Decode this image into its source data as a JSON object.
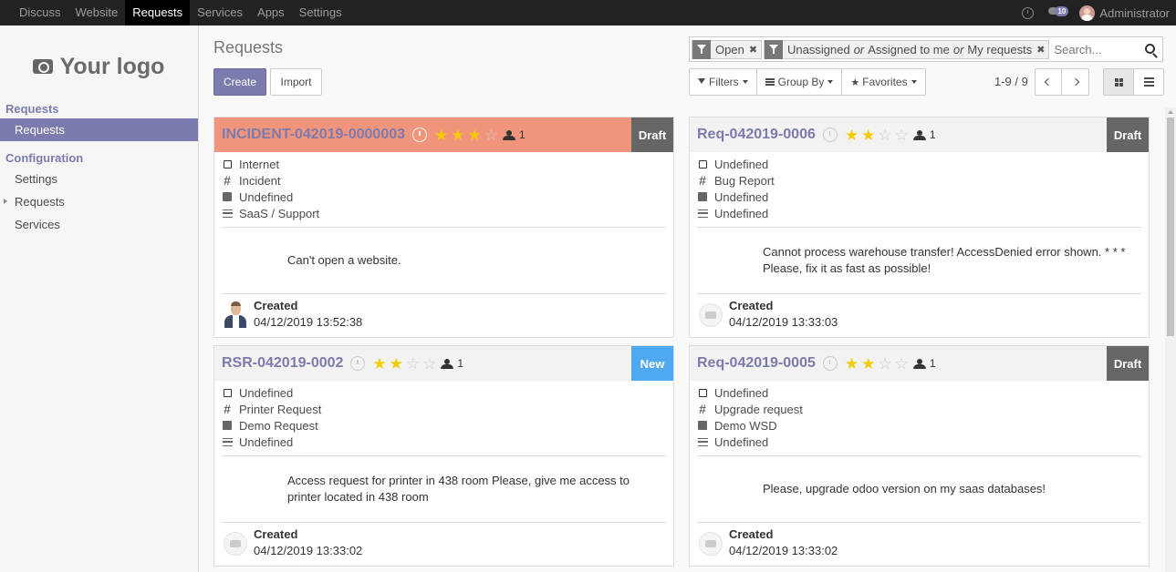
{
  "topbar": {
    "menu": [
      "Discuss",
      "Website",
      "Requests",
      "Services",
      "Apps",
      "Settings"
    ],
    "active_menu": "Requests",
    "chat_count": "10",
    "user": "Administrator"
  },
  "sidebar": {
    "logo_text": "Your logo",
    "section1": "Requests",
    "item_requests": "Requests",
    "section2": "Configuration",
    "items": [
      "Settings",
      "Requests",
      "Services"
    ]
  },
  "control": {
    "title": "Requests",
    "create_label": "Create",
    "import_label": "Import",
    "facet1": "Open",
    "facet2_a": "Unassigned",
    "facet2_or1": "or",
    "facet2_b": "Assigned to me",
    "facet2_or2": "or",
    "facet2_c": "My requests",
    "search_placeholder": "Search...",
    "filters_label": "Filters",
    "groupby_label": "Group By",
    "favorites_label": "Favorites",
    "pager": "1-9 / 9"
  },
  "cards": [
    {
      "title": "INCIDENT-042019-0000003",
      "rating": 3,
      "followers": "1",
      "stage": "Draft",
      "stage_color": "#666666",
      "highlight_color": "#f0957b",
      "fields": [
        "Internet",
        "Incident",
        "Undefined",
        "SaaS / Support"
      ],
      "description": "Can't open a website.",
      "created_label": "Created",
      "created_date": "04/12/2019 13:52:38"
    },
    {
      "title": "Req-042019-0006",
      "rating": 2,
      "followers": "1",
      "stage": "Draft",
      "stage_color": "#666666",
      "fields": [
        "Undefined",
        "Bug Report",
        "Undefined",
        "Undefined"
      ],
      "description": "Cannot process warehouse transfer! AccessDenied error shown. * * * Please, fix it as fast as possible!",
      "created_label": "Created",
      "created_date": "04/12/2019 13:33:03"
    },
    {
      "title": "RSR-042019-0002",
      "rating": 2,
      "followers": "1",
      "stage": "New",
      "stage_color": "#4ea9f1",
      "fields": [
        "Undefined",
        "Printer Request",
        "Demo Request",
        "Undefined"
      ],
      "description": "Access request for printer in 438 room Please, give me access to printer located in 438 room",
      "created_label": "Created",
      "created_date": "04/12/2019 13:33:02"
    },
    {
      "title": "Req-042019-0005",
      "rating": 2,
      "followers": "1",
      "stage": "Draft",
      "stage_color": "#666666",
      "fields": [
        "Undefined",
        "Upgrade request",
        "Demo WSD",
        "Undefined"
      ],
      "description": "Please, upgrade odoo version on my saas databases!",
      "created_label": "Created",
      "created_date": "04/12/2019 13:33:02"
    }
  ]
}
